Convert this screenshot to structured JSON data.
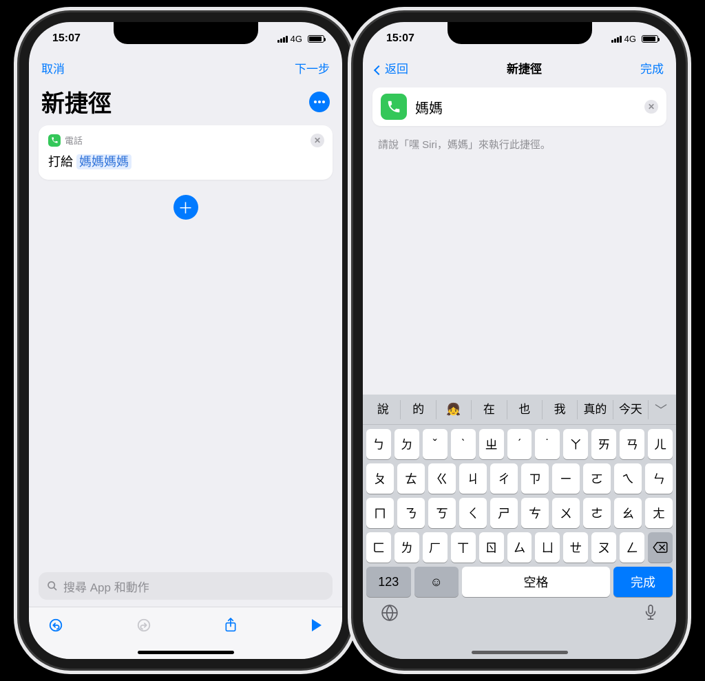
{
  "status": {
    "time": "15:07",
    "carrier": "4G"
  },
  "left": {
    "nav": {
      "cancel": "取消",
      "next": "下一步"
    },
    "title": "新捷徑",
    "card": {
      "app_name": "電話",
      "action_prefix": "打給",
      "contact": "媽媽媽媽"
    },
    "search_placeholder": "搜尋 App 和動作"
  },
  "right": {
    "nav": {
      "back": "返回",
      "title": "新捷徑",
      "done": "完成"
    },
    "input_value": "媽媽",
    "siri_hint": "請說「嘿 Siri，媽媽」來執行此捷徑。",
    "candidates": [
      "說",
      "的",
      "👧",
      "在",
      "也",
      "我",
      "真的",
      "今天"
    ],
    "rows": [
      [
        "ㄅ",
        "ㄉ",
        "ˇ",
        "ˋ",
        "ㄓ",
        "ˊ",
        "˙",
        "ㄚ",
        "ㄞ",
        "ㄢ",
        "ㄦ"
      ],
      [
        "ㄆ",
        "ㄊ",
        "ㄍ",
        "ㄐ",
        "ㄔ",
        "ㄗ",
        "ㄧ",
        "ㄛ",
        "ㄟ",
        "ㄣ"
      ],
      [
        "ㄇ",
        "ㄋ",
        "ㄎ",
        "ㄑ",
        "ㄕ",
        "ㄘ",
        "ㄨ",
        "ㄜ",
        "ㄠ",
        "ㄤ"
      ],
      [
        "ㄈ",
        "ㄌ",
        "ㄏ",
        "ㄒ",
        "ㄖ",
        "ㄙ",
        "ㄩ",
        "ㄝ",
        "ㄡ",
        "ㄥ"
      ]
    ],
    "bottom": {
      "num": "123",
      "space": "空格",
      "done": "完成"
    }
  }
}
